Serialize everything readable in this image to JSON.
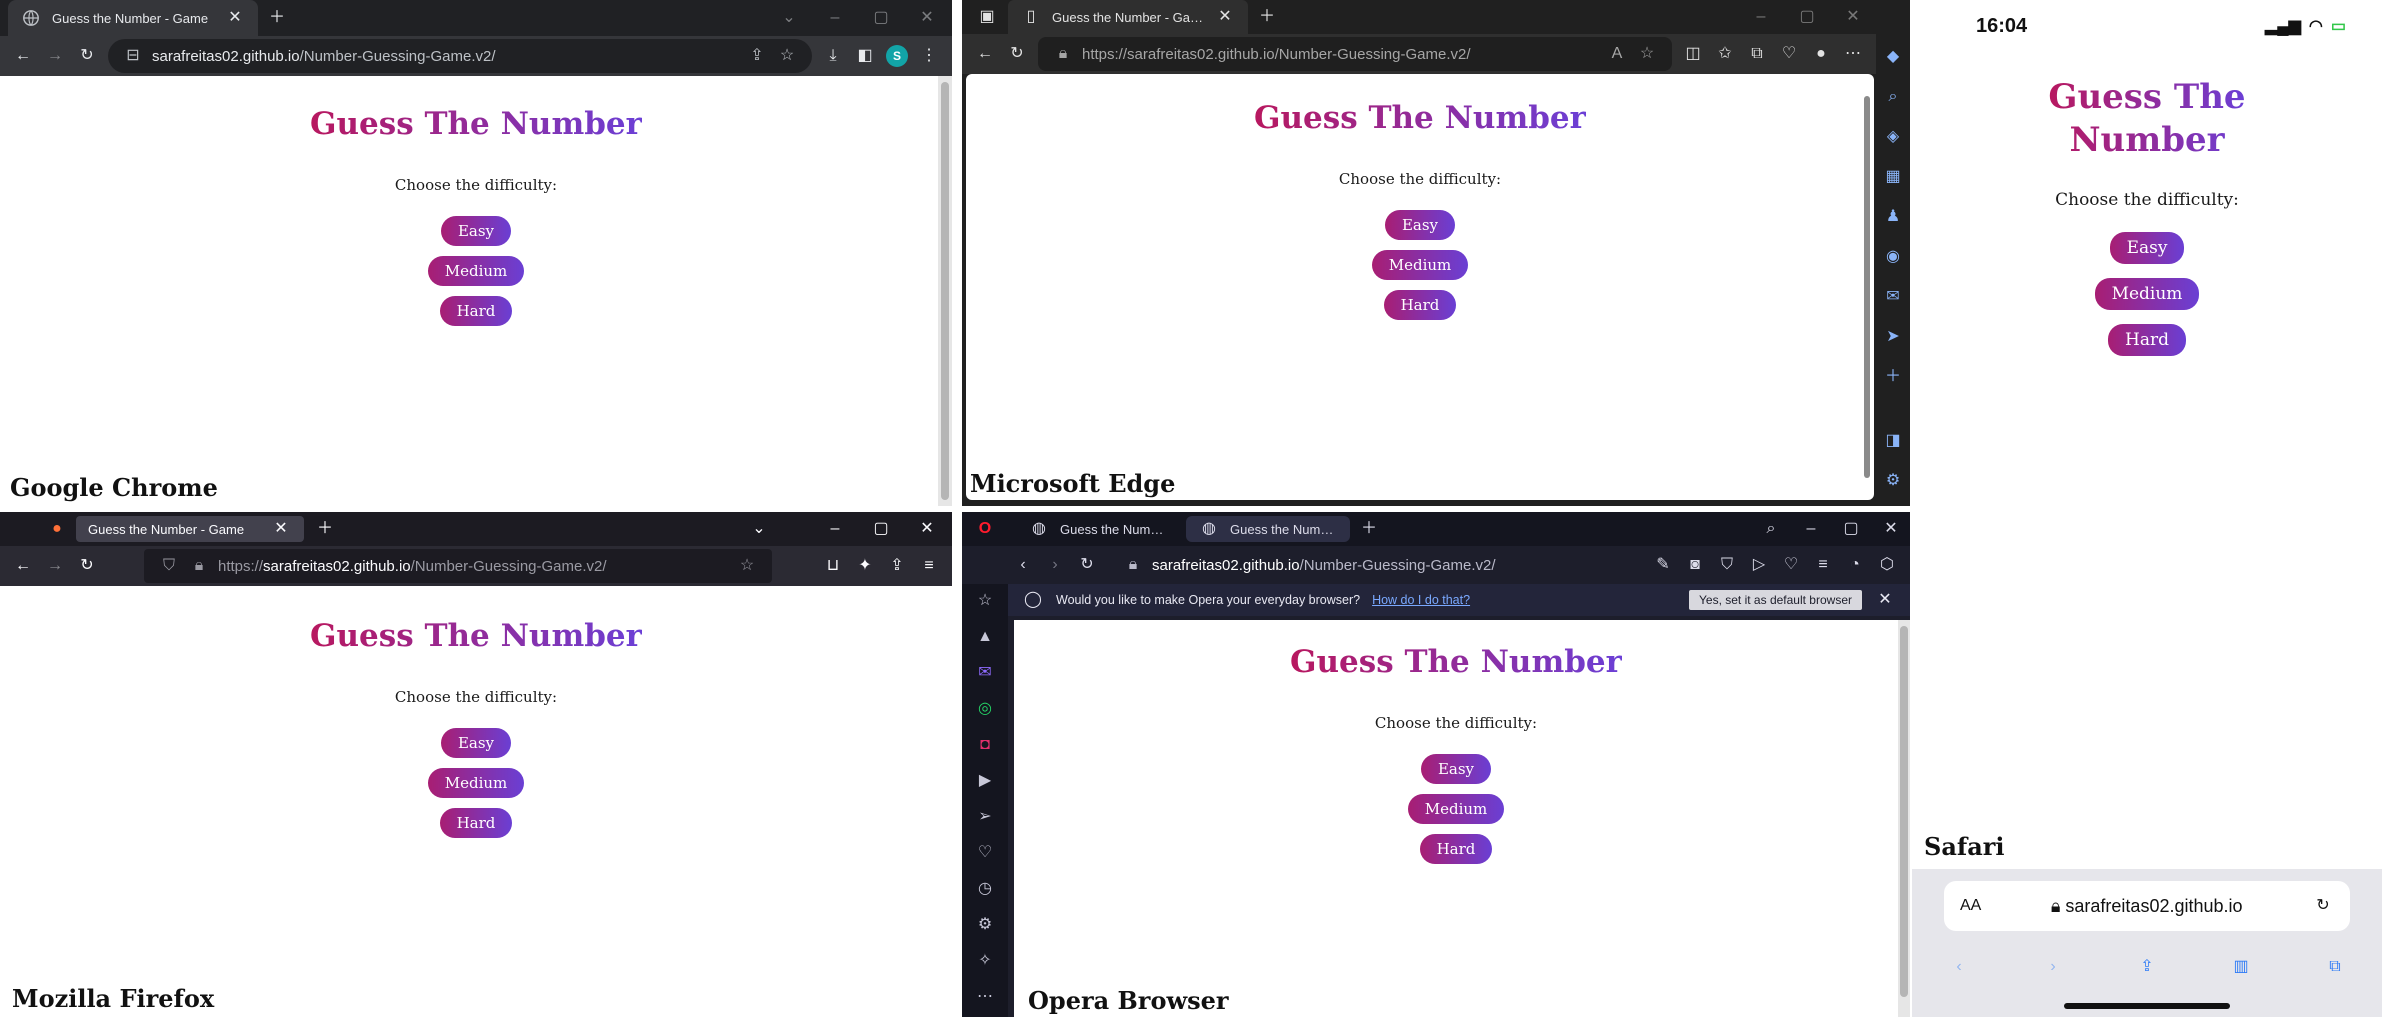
{
  "page": {
    "tab_title": "Guess the Number - Game",
    "url_full": "https://sarafreitas02.github.io/Number-Guessing-Game.v2/",
    "url_host": "sarafreitas02.github.io",
    "url_path": "/Number-Guessing-Game.v2/",
    "url_scheme": "https://",
    "heading": "Guess The Number",
    "heading_line1": "Guess The",
    "heading_line2": "Number",
    "prompt": "Choose the difficulty:",
    "buttons": {
      "easy": "Easy",
      "medium": "Medium",
      "hard": "Hard"
    }
  },
  "browsers": {
    "chrome": {
      "caption": "Google Chrome",
      "profile_initial": "S"
    },
    "edge": {
      "caption": "Microsoft Edge"
    },
    "firefox": {
      "caption": "Mozilla Firefox"
    },
    "opera": {
      "caption": "Opera Browser",
      "tab_title_short": "Guess the Number - Gam",
      "notice_text": "Would you like to make Opera your everyday browser?",
      "notice_link": "How do I do that?",
      "notice_button": "Yes, set it as default browser"
    },
    "safari": {
      "caption": "Safari",
      "time": "16:04",
      "aa_label": "AA"
    }
  },
  "colors": {
    "gradient_start": "#b8185f",
    "gradient_end": "#6b3fd6",
    "safari_accent": "#2f7cf6"
  }
}
